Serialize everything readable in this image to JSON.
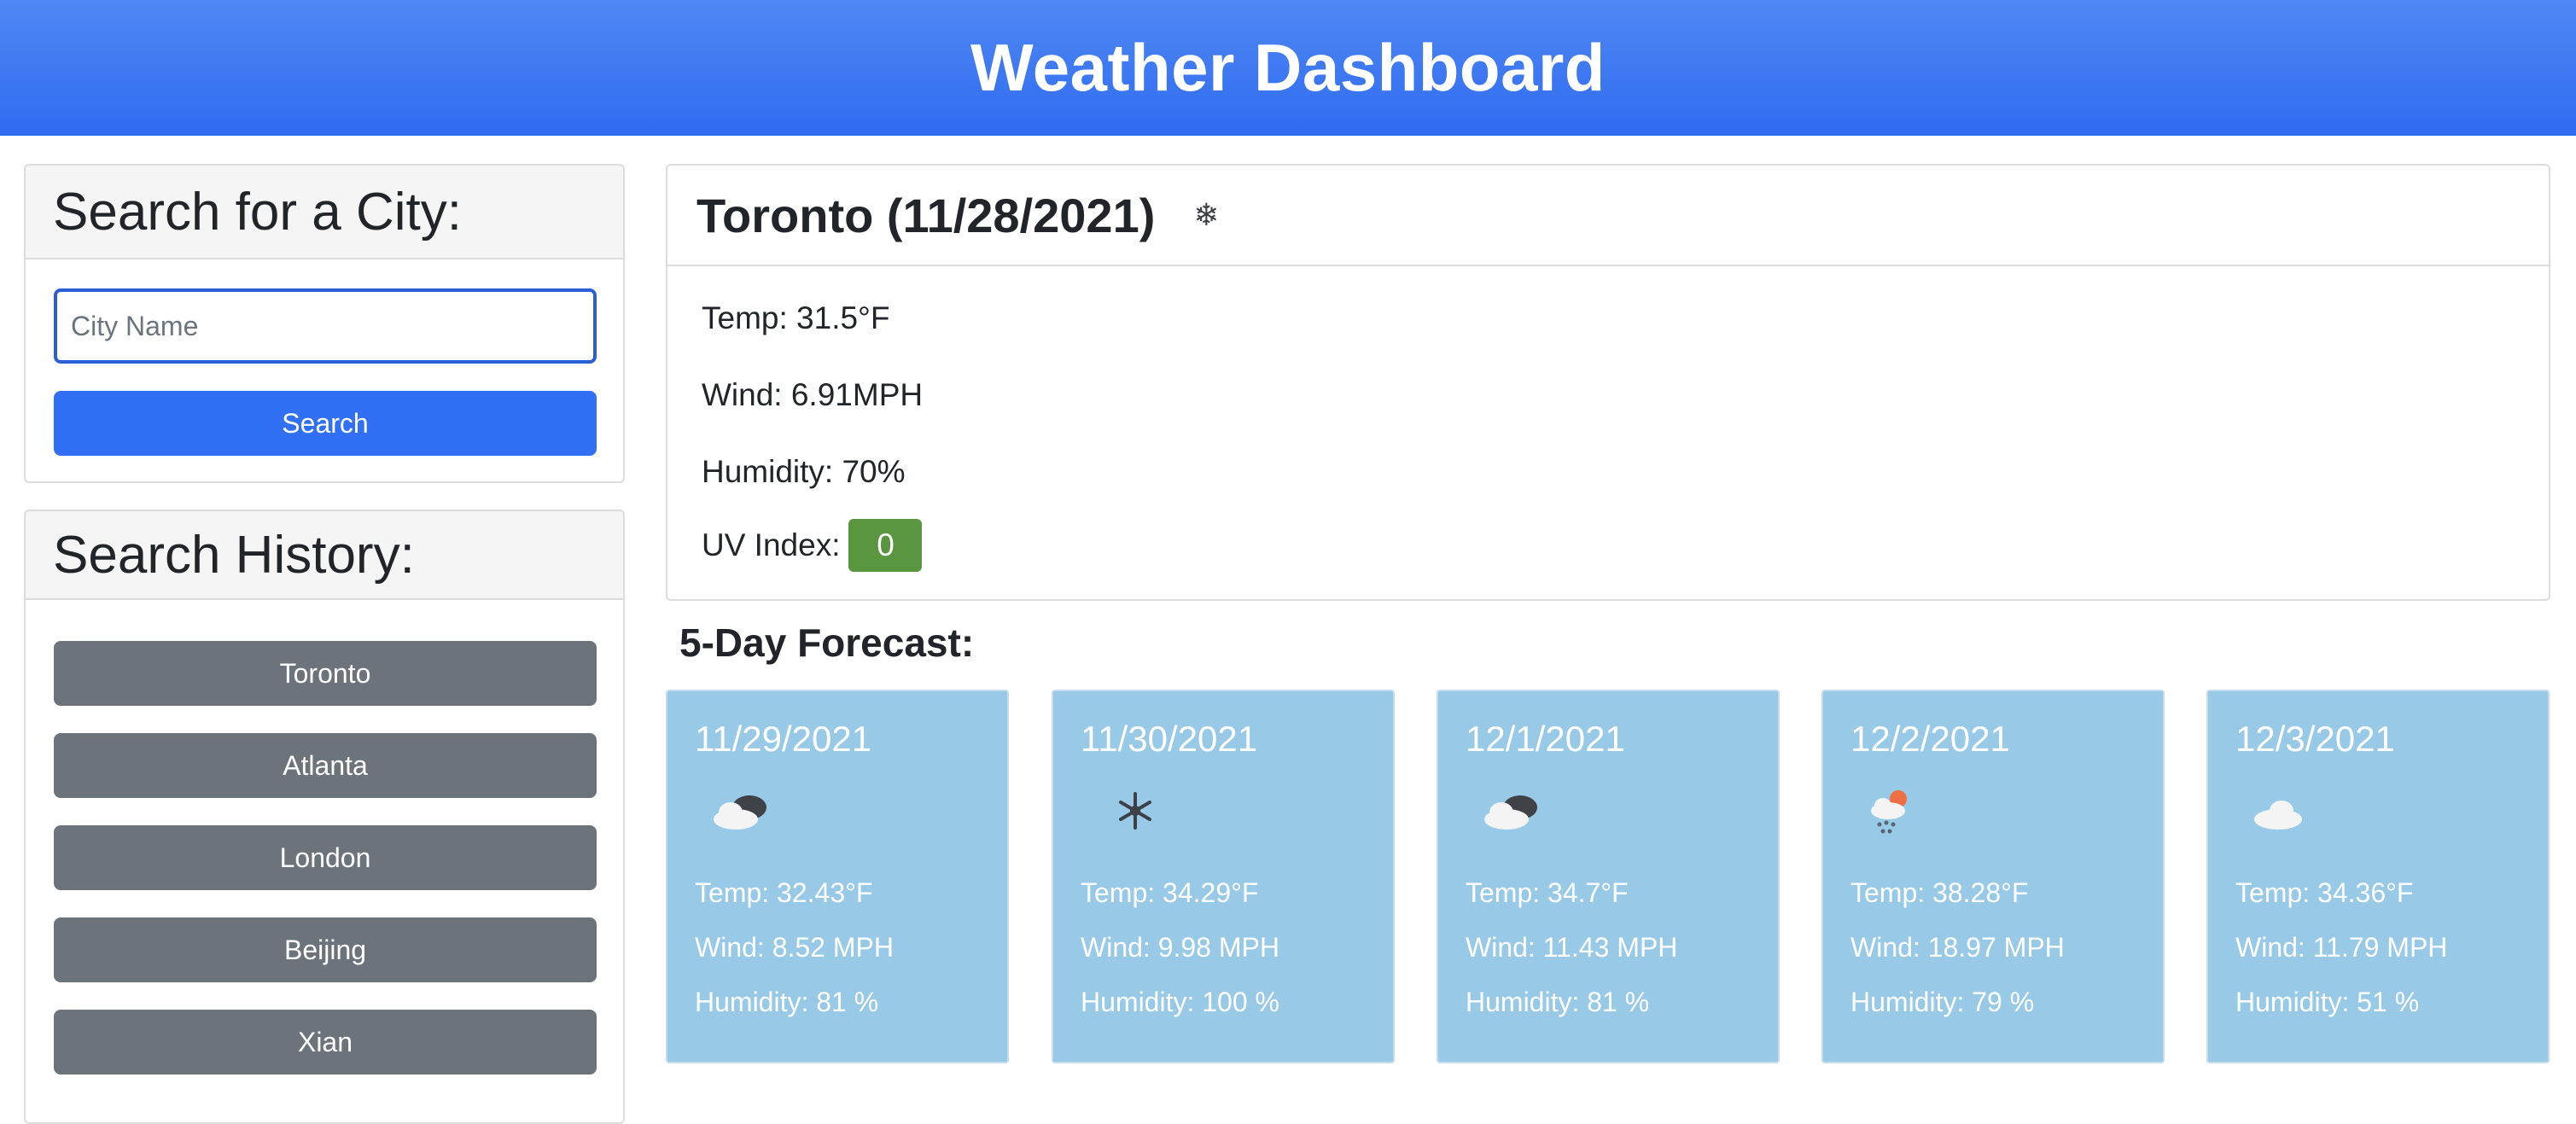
{
  "header": {
    "title": "Weather Dashboard"
  },
  "search": {
    "heading": "Search for a City:",
    "placeholder": "City Name",
    "button_label": "Search"
  },
  "history": {
    "heading": "Search History:",
    "items": [
      "Toronto",
      "Atlanta",
      "London",
      "Beijing",
      "Xian"
    ]
  },
  "current": {
    "title": "Toronto (11/28/2021)",
    "icon": "snow-icon",
    "temp": "Temp: 31.5°F",
    "wind": "Wind: 6.91MPH",
    "humidity": "Humidity: 70%",
    "uv_label": "UV Index:",
    "uv_value": "0",
    "uv_color": "#5a963f"
  },
  "forecast": {
    "heading": "5-Day Forecast:",
    "days": [
      {
        "date": "11/29/2021",
        "icon": "broken-clouds-icon",
        "temp": "Temp: 32.43°F",
        "wind": "Wind: 8.52 MPH",
        "humidity": "Humidity: 81 %"
      },
      {
        "date": "11/30/2021",
        "icon": "snow-icon",
        "temp": "Temp: 34.29°F",
        "wind": "Wind: 9.98 MPH",
        "humidity": "Humidity: 100 %"
      },
      {
        "date": "12/1/2021",
        "icon": "broken-clouds-icon",
        "temp": "Temp: 34.7°F",
        "wind": "Wind: 11.43 MPH",
        "humidity": "Humidity: 81 %"
      },
      {
        "date": "12/2/2021",
        "icon": "rain-snow-sun-icon",
        "temp": "Temp: 38.28°F",
        "wind": "Wind: 18.97 MPH",
        "humidity": "Humidity: 79 %"
      },
      {
        "date": "12/3/2021",
        "icon": "cloud-icon",
        "temp": "Temp: 34.36°F",
        "wind": "Wind: 11.79 MPH",
        "humidity": "Humidity: 51 %"
      }
    ]
  },
  "colors": {
    "header": "#3a75f2",
    "search_button": "#3170f4",
    "history_button": "#6c737b",
    "forecast_card": "#98cae8"
  }
}
